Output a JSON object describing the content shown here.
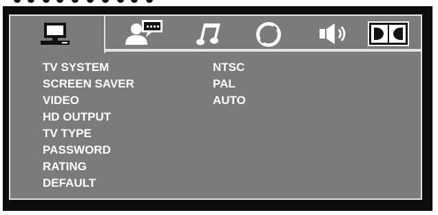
{
  "tabs": [
    {
      "icon": "monitor-icon",
      "active": true
    },
    {
      "icon": "speaker-chat-icon",
      "active": false
    },
    {
      "icon": "music-note-icon",
      "active": false
    },
    {
      "icon": "contrast-icon",
      "active": false
    },
    {
      "icon": "volume-icon",
      "active": false
    },
    {
      "icon": "dolby-icon",
      "active": false
    }
  ],
  "menu": {
    "items": [
      "TV SYSTEM",
      "SCREEN SAVER",
      "VIDEO",
      "HD OUTPUT",
      "TV TYPE",
      "PASSWORD",
      "RATING",
      "DEFAULT"
    ],
    "options": [
      "NTSC",
      "PAL",
      "AUTO"
    ]
  },
  "colors": {
    "frame": "#0c0c0c",
    "panel": "#7b7b7b",
    "border": "#e4e4e4",
    "text": "#ffffff"
  }
}
